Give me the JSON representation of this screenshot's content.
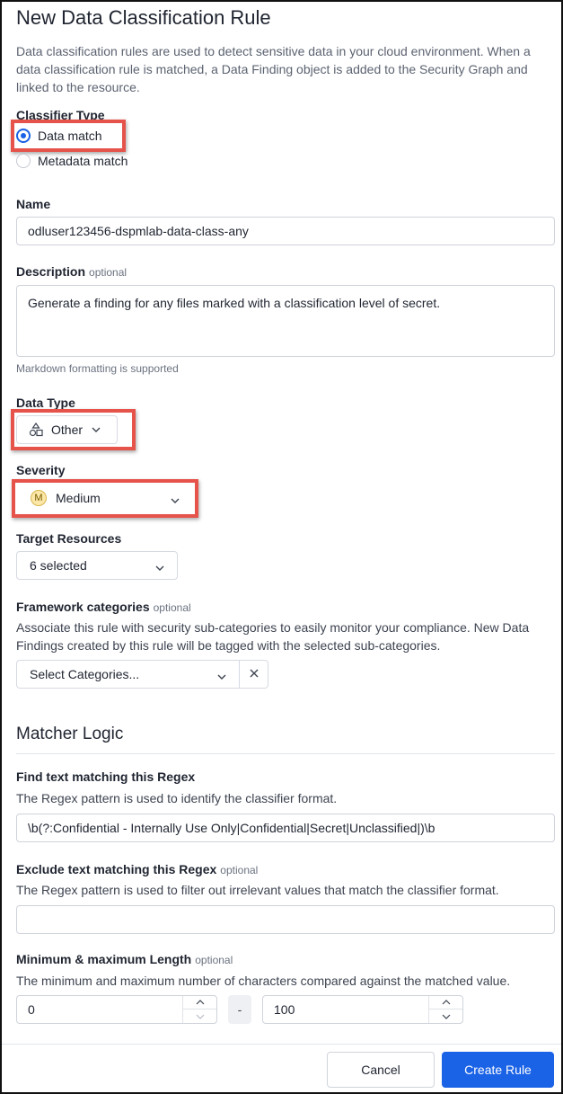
{
  "header": {
    "title": "New Data Classification Rule",
    "intro": "Data classification rules are used to detect sensitive data in your cloud environment. When a data classification rule is matched, a Data Finding object is added to the Security Graph and linked to the resource."
  },
  "classifier": {
    "label": "Classifier Type",
    "options": [
      {
        "label": "Data match",
        "selected": true
      },
      {
        "label": "Metadata match",
        "selected": false
      }
    ]
  },
  "name": {
    "label": "Name",
    "value": "odluser123456-dspmlab-data-class-any"
  },
  "description": {
    "label": "Description",
    "optional": "optional",
    "value": "Generate a finding for any files marked with a classification level of secret.",
    "hint": "Markdown formatting is supported"
  },
  "data_type": {
    "label": "Data Type",
    "value": "Other",
    "icon": "shapes-icon"
  },
  "severity": {
    "label": "Severity",
    "badge": "M",
    "value": "Medium",
    "badge_color": "#fbe7a8"
  },
  "target": {
    "label": "Target Resources",
    "value": "6 selected"
  },
  "framework": {
    "label": "Framework categories",
    "optional": "optional",
    "help": "Associate this rule with security sub-categories to easily monitor your compliance. New Data Findings created by this rule will be tagged with the selected sub-categories.",
    "placeholder": "Select Categories..."
  },
  "matcher": {
    "heading": "Matcher Logic",
    "find_label": "Find text matching this Regex",
    "find_help": "The Regex pattern is used to identify the classifier format.",
    "find_value": "\\b(?:Confidential - Internally Use Only|Confidential|Secret|Unclassified|)\\b",
    "exclude_label": "Exclude text matching this Regex",
    "exclude_optional": "optional",
    "exclude_help": "The Regex pattern is used to filter out irrelevant values that match the classifier format.",
    "exclude_value": "",
    "length_label": "Minimum & maximum Length",
    "length_optional": "optional",
    "length_help": "The minimum and maximum number of characters compared against the matched value.",
    "min_value": "0",
    "separator": "-",
    "max_value": "100"
  },
  "footer": {
    "cancel_label": "Cancel",
    "create_label": "Create Rule"
  },
  "colors": {
    "primary": "#1a62e6",
    "highlight": "#e5534b"
  }
}
